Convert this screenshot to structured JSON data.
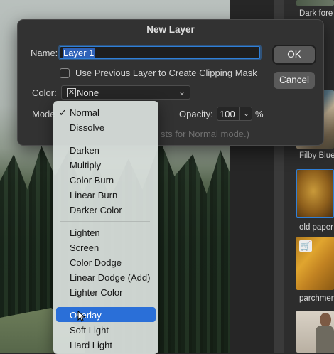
{
  "library": {
    "items": [
      {
        "label": "Dark fore"
      },
      {
        "label": "Filby Blue"
      },
      {
        "label": "old paper"
      },
      {
        "label": "parchmen"
      }
    ]
  },
  "dialog": {
    "title": "New Layer",
    "name_label": "Name:",
    "name_value": "Layer 1",
    "clipping_label": "Use Previous Layer to Create Clipping Mask",
    "clipping_checked": false,
    "color_label": "Color:",
    "color_swatch": "✕",
    "color_value": "None",
    "mode_label": "Mode",
    "opacity_label": "Opacity:",
    "opacity_value": "100",
    "opacity_unit": "%",
    "hint_text": "sts for Normal mode.)",
    "ok_label": "OK",
    "cancel_label": "Cancel"
  },
  "mode_menu": {
    "selected": "Normal",
    "hovered": "Overlay",
    "groups": [
      [
        "Normal",
        "Dissolve"
      ],
      [
        "Darken",
        "Multiply",
        "Color Burn",
        "Linear Burn",
        "Darker Color"
      ],
      [
        "Lighten",
        "Screen",
        "Color Dodge",
        "Linear Dodge (Add)",
        "Lighter Color"
      ],
      [
        "Overlay",
        "Soft Light",
        "Hard Light"
      ]
    ]
  },
  "colors": {
    "accent": "#2a6fd8",
    "focus_ring": "#2f7fd8",
    "dialog_bg": "#323232",
    "menu_bg": "#dae1de"
  }
}
